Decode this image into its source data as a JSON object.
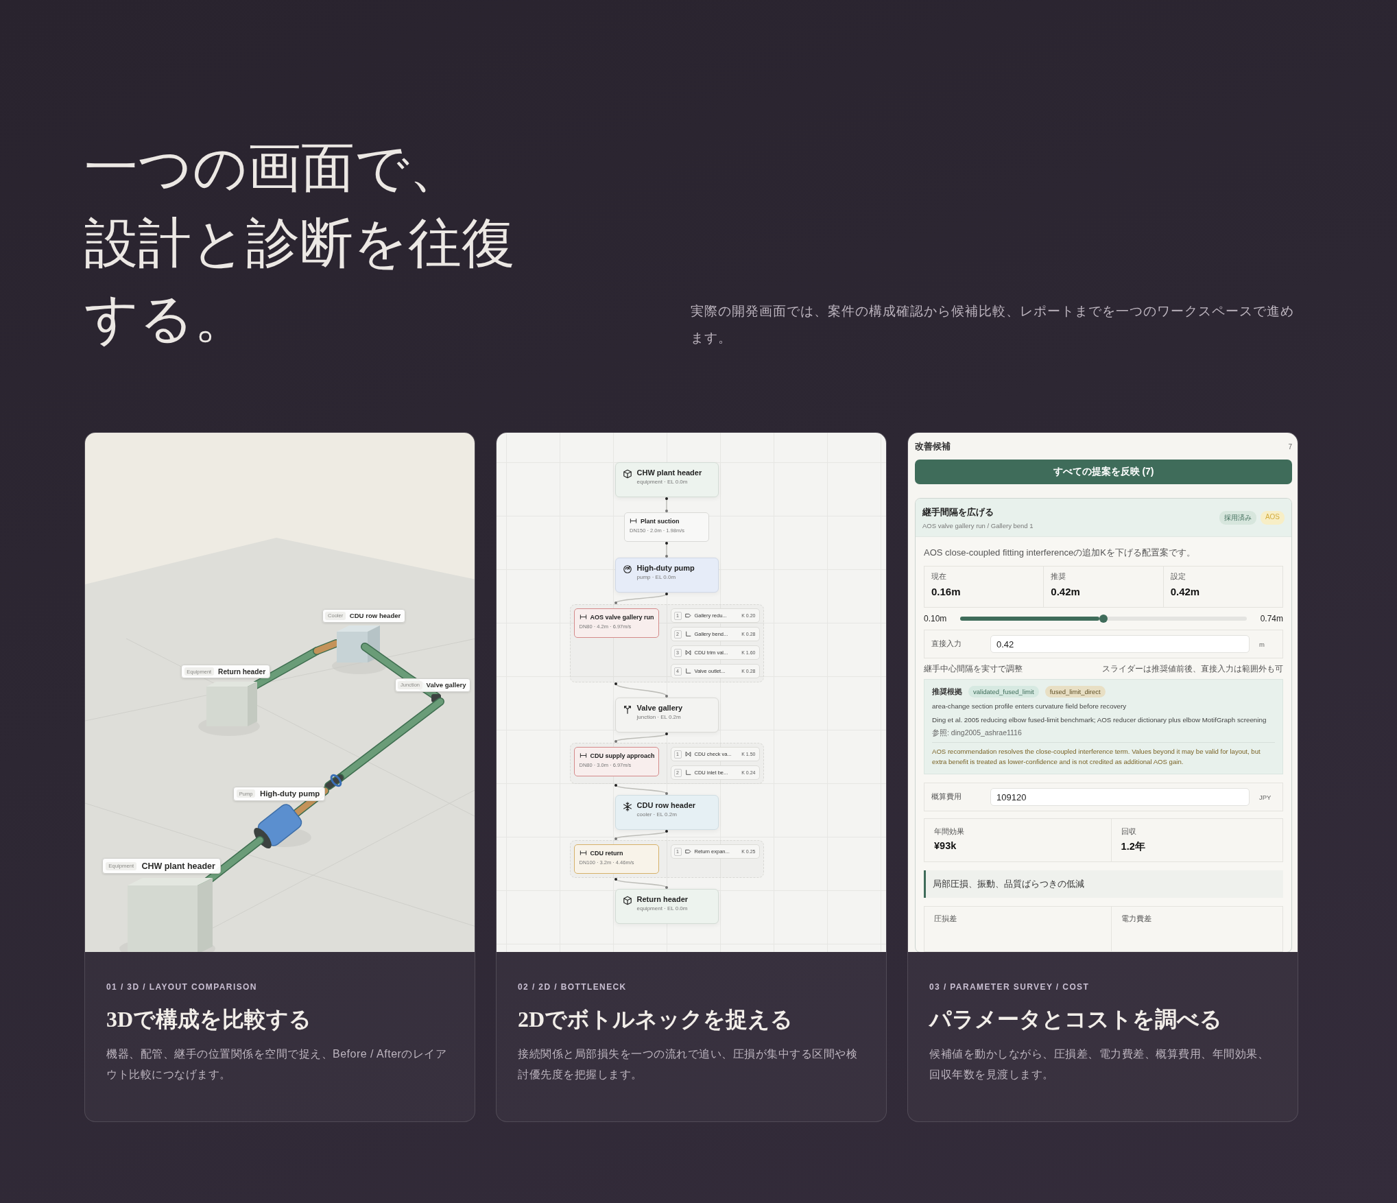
{
  "hero": {
    "title_lines": [
      "一つの画面で、",
      "設計と診断を往復",
      "する。"
    ],
    "lead": "実際の開発画面では、案件の構成確認から候補比較、レポートまでを一つのワークスペースで進めます。"
  },
  "cards": [
    {
      "kind": "scene",
      "eyebrow": "01 / 3D / LAYOUT COMPARISON",
      "title": "3Dで構成を比較する",
      "description": "機器、配管、継手の位置関係を空間で捉え、Before / Afterのレイアウト比較につなげます。",
      "labels": [
        {
          "tag": "Cooler",
          "name": "CDU row header"
        },
        {
          "tag": "Equipment",
          "name": "Return header"
        },
        {
          "tag": "Junction",
          "name": "Valve gallery"
        },
        {
          "tag": "Pump",
          "name": "High-duty pump"
        },
        {
          "tag": "Equipment",
          "name": "CHW plant header"
        }
      ]
    },
    {
      "kind": "diagram",
      "eyebrow": "02 / 2D / BOTTLENECK",
      "title": "2Dでボトルネックを捉える",
      "description": "接続関係と局部損失を一つの流れで追い、圧損が集中する区間や検討優先度を把握します。",
      "flow": [
        {
          "kind": "equipment",
          "name": "CHW plant header",
          "meta": "equipment · EL 0.0m"
        },
        {
          "kind": "segment",
          "color": "#d9d9d6",
          "name": "Plant suction",
          "meta": "DN150 · 2.0m · 1.98m/s"
        },
        {
          "kind": "pump",
          "name": "High-duty pump",
          "meta": "pump · EL 0.0m"
        },
        {
          "kind": "segment",
          "color": "#d48a8a",
          "name": "AOS valve gallery run",
          "meta": "DN80 · 4.2m · 6.97m/s",
          "fittings": [
            {
              "index": "1",
              "kind": "reducer",
              "name": "Gallery redu...",
              "k": "K 0.20"
            },
            {
              "index": "2",
              "kind": "bend",
              "name": "Gallery bend...",
              "k": "K 0.28"
            },
            {
              "index": "3",
              "kind": "valve",
              "name": "CDU trim val...",
              "k": "K 1.60"
            },
            {
              "index": "4",
              "kind": "bend",
              "name": "Valve outlet...",
              "k": "K 0.28"
            }
          ]
        },
        {
          "kind": "junction",
          "name": "Valve gallery",
          "meta": "junction · EL 0.2m"
        },
        {
          "kind": "segment",
          "color": "#d48a8a",
          "name": "CDU supply approach",
          "meta": "DN80 · 3.0m · 6.97m/s",
          "fittings": [
            {
              "index": "1",
              "kind": "valve",
              "name": "CDU check va...",
              "k": "K 1.50"
            },
            {
              "index": "2",
              "kind": "bend",
              "name": "CDU inlet be...",
              "k": "K 0.24"
            }
          ]
        },
        {
          "kind": "cooler",
          "name": "CDU row header",
          "meta": "cooler · EL 0.2m"
        },
        {
          "kind": "segment",
          "color": "#d6b068",
          "name": "CDU return",
          "meta": "DN100 · 3.2m · 4.46m/s",
          "fittings": [
            {
              "index": "1",
              "kind": "reducer",
              "name": "Return expan...",
              "k": "K 0.25"
            }
          ]
        },
        {
          "kind": "equipment",
          "name": "Return header",
          "meta": "equipment · EL 0.0m"
        }
      ]
    },
    {
      "kind": "panel",
      "eyebrow": "03 / PARAMETER SURVEY / COST",
      "title": "パラメータとコストを調べる",
      "description": "候補値を動かしながら、圧損差、電力費差、概算費用、年間効果、回収年数を見渡します。",
      "panel": {
        "title": "改善候補",
        "count": "7",
        "apply_button": "すべての提案を反映 (7)",
        "proposal": {
          "title": "継手間隔を広げる",
          "path": "AOS valve gallery run / Gallery bend 1",
          "badges": [
            {
              "label": "採用済み",
              "kind": "status"
            },
            {
              "label": "AOS",
              "kind": "source"
            }
          ],
          "description": "AOS close-coupled fitting interferenceの追加Kを下げる配置案です。",
          "stats": [
            {
              "label": "現在",
              "value": "0.16m"
            },
            {
              "label": "推奨",
              "value": "0.42m"
            },
            {
              "label": "設定",
              "value": "0.42m"
            }
          ],
          "slider": {
            "min": "0.10m",
            "max": "0.74m",
            "level": 0.5
          },
          "direct_input": {
            "label": "直接入力",
            "value": "0.42",
            "unit": "m"
          },
          "hint_left": "継手中心間隔を実寸で調整",
          "hint_right": "スライダーは推奨値前後、直接入力は範囲外も可",
          "rationale": {
            "title": "推奨根拠",
            "tags": [
              {
                "label": "validated_fused_limit",
                "kind": "validation"
              },
              {
                "label": "fused_limit_direct",
                "kind": "method"
              }
            ],
            "lines": [
              "area-change section profile enters curvature field before recovery",
              "Ding et al. 2005 reducing elbow fused-limit benchmark; AOS reducer dictionary plus elbow MotifGraph screening"
            ],
            "reference": "参照: ding2005_ashrae1116",
            "note": "AOS recommendation resolves the close-coupled interference term. Values beyond it may be valid for layout, but extra benefit is treated as lower-confidence and is not credited as additional AOS gain."
          },
          "cost": {
            "label": "概算費用",
            "value": "109120",
            "unit": "JPY"
          },
          "results": [
            {
              "label": "年間効果",
              "value": "¥93k"
            },
            {
              "label": "回収",
              "value": "1.2年"
            }
          ],
          "section": "局部圧損、振動、品質ばらつきの低減",
          "next_results": [
            {
              "label": "圧損差"
            },
            {
              "label": "電力費差"
            }
          ]
        }
      }
    }
  ]
}
